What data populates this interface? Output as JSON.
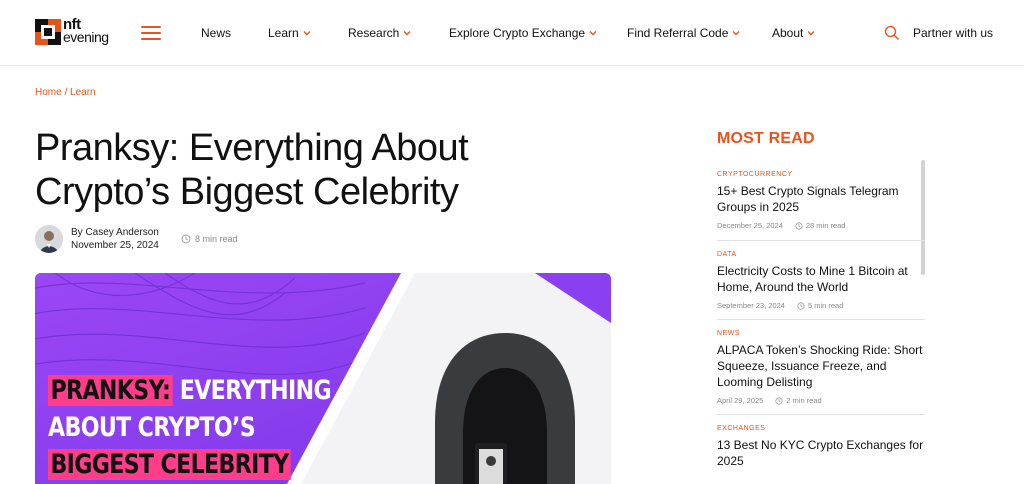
{
  "header": {
    "logo": {
      "line1": "nft",
      "line2": "evening"
    },
    "nav": [
      {
        "label": "News",
        "has_chevron": false
      },
      {
        "label": "Learn",
        "has_chevron": true
      },
      {
        "label": "Research",
        "has_chevron": true
      },
      {
        "label": "Explore Crypto Exchange",
        "has_chevron": true
      },
      {
        "label": "Find Referral Code",
        "has_chevron": true
      },
      {
        "label": "About",
        "has_chevron": true
      }
    ],
    "partner_label": "Partner with us",
    "icons": {
      "menu": "hamburger-menu-icon",
      "search": "search-icon"
    }
  },
  "breadcrumb": {
    "home": "Home",
    "separator": "/",
    "current": "Learn"
  },
  "article": {
    "title": "Pranksy: Everything About Crypto’s Biggest Celebrity",
    "author": "By Casey Anderson",
    "date": "November 25, 2024",
    "read_time": "8 min read",
    "hero": {
      "word1": "PRANKSY:",
      "line1_rest": "EVERYTHING",
      "line2": "ABOUT CRYPTO’S",
      "line3": "BIGGEST CELEBRITY"
    }
  },
  "sidebar": {
    "heading": "MOST READ",
    "items": [
      {
        "category": "CRYPTOCURRENCY",
        "title": "15+ Best Crypto Signals Telegram Groups in 2025",
        "date": "December 25, 2024",
        "read_time": "28 min read"
      },
      {
        "category": "DATA",
        "title": "Electricity Costs to Mine 1 Bitcoin at Home, Around the World",
        "date": "September 23, 2024",
        "read_time": "5 min read"
      },
      {
        "category": "NEWS",
        "title": "ALPACA Token’s Shocking Ride: Short Squeeze, Issuance Freeze, and Looming Delisting",
        "date": "April 29, 2025",
        "read_time": "2 min read"
      },
      {
        "category": "EXCHANGES",
        "title": "13 Best No KYC Crypto Exchanges for 2025"
      }
    ]
  },
  "colors": {
    "accent": "#e8531c",
    "hero_purple": "#8a3ff0",
    "hero_pink": "#ff3d8b"
  }
}
